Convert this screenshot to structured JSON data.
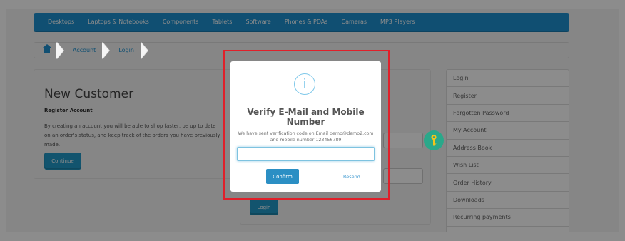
{
  "topnav": {
    "items": [
      "Desktops",
      "Laptops & Notebooks",
      "Components",
      "Tablets",
      "Software",
      "Phones & PDAs",
      "Cameras",
      "MP3 Players"
    ]
  },
  "breadcrumb": {
    "home_icon": "home-icon",
    "items": [
      "Account",
      "Login"
    ]
  },
  "new_customer": {
    "title": "New Customer",
    "subtitle": "Register Account",
    "text": "By creating an account you will be able to shop faster, be up to date on an order's status, and keep track of the orders you have previously made.",
    "continue_label": "Continue"
  },
  "returning": {
    "login_label": "Login"
  },
  "sidebar": {
    "items": [
      "Login",
      "Register",
      "Forgotten Password",
      "My Account",
      "Address Book",
      "Wish List",
      "Order History",
      "Downloads",
      "Recurring payments"
    ]
  },
  "modal": {
    "icon": "info-icon",
    "title": "Verify E-Mail and Mobile Number",
    "message": "We have sent verification code on Email demo@demo2.com and mobile number 123456789",
    "input_value": "",
    "input_placeholder": "",
    "confirm_label": "Confirm",
    "resend_label": "Resend"
  },
  "colors": {
    "accent": "#1e91cf",
    "highlight_border": "#e0202a",
    "key_badge": "#2aa88a"
  }
}
